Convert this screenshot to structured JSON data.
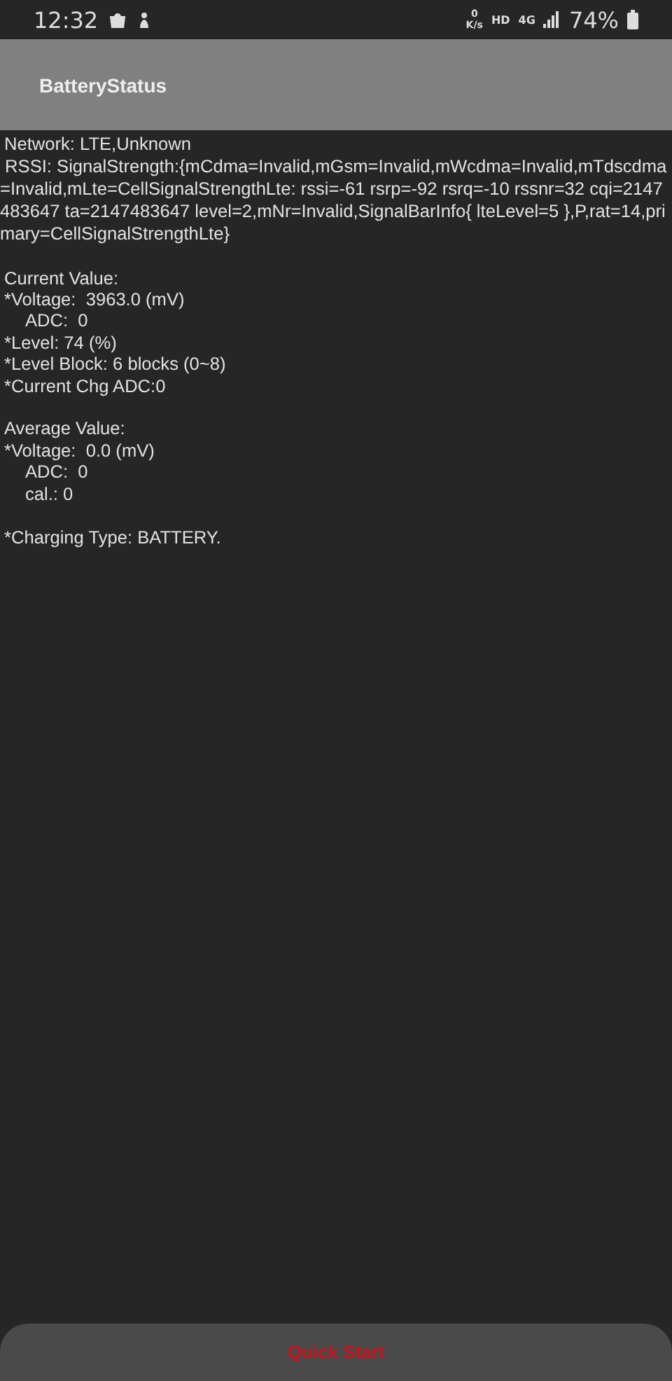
{
  "status_bar": {
    "time": "12:32",
    "speed_value": "0",
    "speed_unit": "K/s",
    "hd": "HD",
    "network": "4G",
    "battery": "74%"
  },
  "app_bar": {
    "title": "BatteryStatus"
  },
  "network": {
    "line": "Network: LTE,Unknown",
    "rssi": "RSSI: SignalStrength:{mCdma=Invalid,mGsm=Invalid,mWcdma=Invalid,mTdscdma=Invalid,mLte=CellSignalStrengthLte: rssi=-61 rsrp=-92 rsrq=-10 rssnr=32 cqi=2147483647 ta=2147483647 level=2,mNr=Invalid,SignalBarInfo{ lteLevel=5 },P,rat=14,primary=CellSignalStrengthLte}"
  },
  "sections": [
    {
      "heading": "Current Value:",
      "lines": [
        {
          "text": "*Voltage:  3963.0 (mV)",
          "indented": false
        },
        {
          "text": "ADC:  0",
          "indented": true
        },
        {
          "text": "*Level: 74 (%)",
          "indented": false
        },
        {
          "text": "*Level Block: 6 blocks (0~8)",
          "indented": false
        },
        {
          "text": "*Current Chg ADC:0",
          "indented": false
        }
      ]
    },
    {
      "heading": "Average Value:",
      "lines": [
        {
          "text": "*Voltage:  0.0 (mV)",
          "indented": false
        },
        {
          "text": "ADC:  0",
          "indented": true
        },
        {
          "text": "cal.: 0",
          "indented": true
        }
      ]
    },
    {
      "lines": [
        {
          "text": "*Charging Type: BATTERY.",
          "indented": false
        }
      ]
    }
  ],
  "button": {
    "label": "Quick Start"
  }
}
